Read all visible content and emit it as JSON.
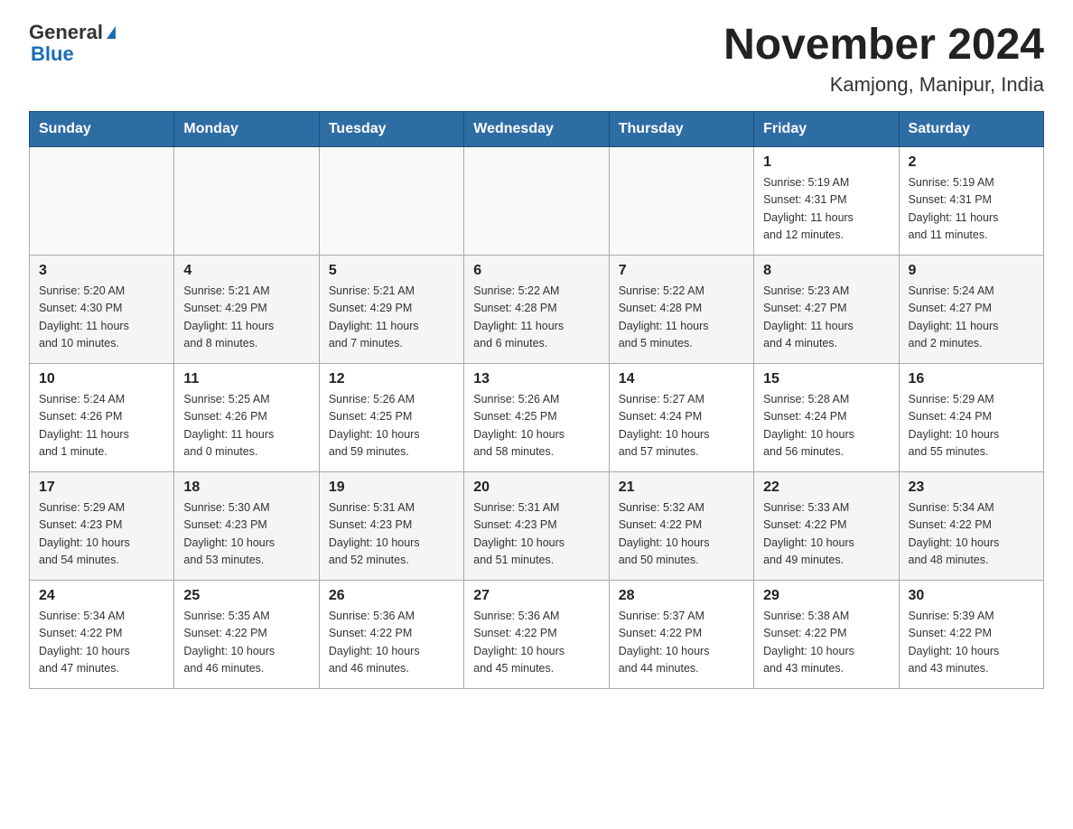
{
  "logo": {
    "text_general": "General",
    "text_blue": "Blue"
  },
  "title": "November 2024",
  "subtitle": "Kamjong, Manipur, India",
  "days_of_week": [
    "Sunday",
    "Monday",
    "Tuesday",
    "Wednesday",
    "Thursday",
    "Friday",
    "Saturday"
  ],
  "weeks": [
    [
      {
        "day": "",
        "info": ""
      },
      {
        "day": "",
        "info": ""
      },
      {
        "day": "",
        "info": ""
      },
      {
        "day": "",
        "info": ""
      },
      {
        "day": "",
        "info": ""
      },
      {
        "day": "1",
        "info": "Sunrise: 5:19 AM\nSunset: 4:31 PM\nDaylight: 11 hours\nand 12 minutes."
      },
      {
        "day": "2",
        "info": "Sunrise: 5:19 AM\nSunset: 4:31 PM\nDaylight: 11 hours\nand 11 minutes."
      }
    ],
    [
      {
        "day": "3",
        "info": "Sunrise: 5:20 AM\nSunset: 4:30 PM\nDaylight: 11 hours\nand 10 minutes."
      },
      {
        "day": "4",
        "info": "Sunrise: 5:21 AM\nSunset: 4:29 PM\nDaylight: 11 hours\nand 8 minutes."
      },
      {
        "day": "5",
        "info": "Sunrise: 5:21 AM\nSunset: 4:29 PM\nDaylight: 11 hours\nand 7 minutes."
      },
      {
        "day": "6",
        "info": "Sunrise: 5:22 AM\nSunset: 4:28 PM\nDaylight: 11 hours\nand 6 minutes."
      },
      {
        "day": "7",
        "info": "Sunrise: 5:22 AM\nSunset: 4:28 PM\nDaylight: 11 hours\nand 5 minutes."
      },
      {
        "day": "8",
        "info": "Sunrise: 5:23 AM\nSunset: 4:27 PM\nDaylight: 11 hours\nand 4 minutes."
      },
      {
        "day": "9",
        "info": "Sunrise: 5:24 AM\nSunset: 4:27 PM\nDaylight: 11 hours\nand 2 minutes."
      }
    ],
    [
      {
        "day": "10",
        "info": "Sunrise: 5:24 AM\nSunset: 4:26 PM\nDaylight: 11 hours\nand 1 minute."
      },
      {
        "day": "11",
        "info": "Sunrise: 5:25 AM\nSunset: 4:26 PM\nDaylight: 11 hours\nand 0 minutes."
      },
      {
        "day": "12",
        "info": "Sunrise: 5:26 AM\nSunset: 4:25 PM\nDaylight: 10 hours\nand 59 minutes."
      },
      {
        "day": "13",
        "info": "Sunrise: 5:26 AM\nSunset: 4:25 PM\nDaylight: 10 hours\nand 58 minutes."
      },
      {
        "day": "14",
        "info": "Sunrise: 5:27 AM\nSunset: 4:24 PM\nDaylight: 10 hours\nand 57 minutes."
      },
      {
        "day": "15",
        "info": "Sunrise: 5:28 AM\nSunset: 4:24 PM\nDaylight: 10 hours\nand 56 minutes."
      },
      {
        "day": "16",
        "info": "Sunrise: 5:29 AM\nSunset: 4:24 PM\nDaylight: 10 hours\nand 55 minutes."
      }
    ],
    [
      {
        "day": "17",
        "info": "Sunrise: 5:29 AM\nSunset: 4:23 PM\nDaylight: 10 hours\nand 54 minutes."
      },
      {
        "day": "18",
        "info": "Sunrise: 5:30 AM\nSunset: 4:23 PM\nDaylight: 10 hours\nand 53 minutes."
      },
      {
        "day": "19",
        "info": "Sunrise: 5:31 AM\nSunset: 4:23 PM\nDaylight: 10 hours\nand 52 minutes."
      },
      {
        "day": "20",
        "info": "Sunrise: 5:31 AM\nSunset: 4:23 PM\nDaylight: 10 hours\nand 51 minutes."
      },
      {
        "day": "21",
        "info": "Sunrise: 5:32 AM\nSunset: 4:22 PM\nDaylight: 10 hours\nand 50 minutes."
      },
      {
        "day": "22",
        "info": "Sunrise: 5:33 AM\nSunset: 4:22 PM\nDaylight: 10 hours\nand 49 minutes."
      },
      {
        "day": "23",
        "info": "Sunrise: 5:34 AM\nSunset: 4:22 PM\nDaylight: 10 hours\nand 48 minutes."
      }
    ],
    [
      {
        "day": "24",
        "info": "Sunrise: 5:34 AM\nSunset: 4:22 PM\nDaylight: 10 hours\nand 47 minutes."
      },
      {
        "day": "25",
        "info": "Sunrise: 5:35 AM\nSunset: 4:22 PM\nDaylight: 10 hours\nand 46 minutes."
      },
      {
        "day": "26",
        "info": "Sunrise: 5:36 AM\nSunset: 4:22 PM\nDaylight: 10 hours\nand 46 minutes."
      },
      {
        "day": "27",
        "info": "Sunrise: 5:36 AM\nSunset: 4:22 PM\nDaylight: 10 hours\nand 45 minutes."
      },
      {
        "day": "28",
        "info": "Sunrise: 5:37 AM\nSunset: 4:22 PM\nDaylight: 10 hours\nand 44 minutes."
      },
      {
        "day": "29",
        "info": "Sunrise: 5:38 AM\nSunset: 4:22 PM\nDaylight: 10 hours\nand 43 minutes."
      },
      {
        "day": "30",
        "info": "Sunrise: 5:39 AM\nSunset: 4:22 PM\nDaylight: 10 hours\nand 43 minutes."
      }
    ]
  ]
}
